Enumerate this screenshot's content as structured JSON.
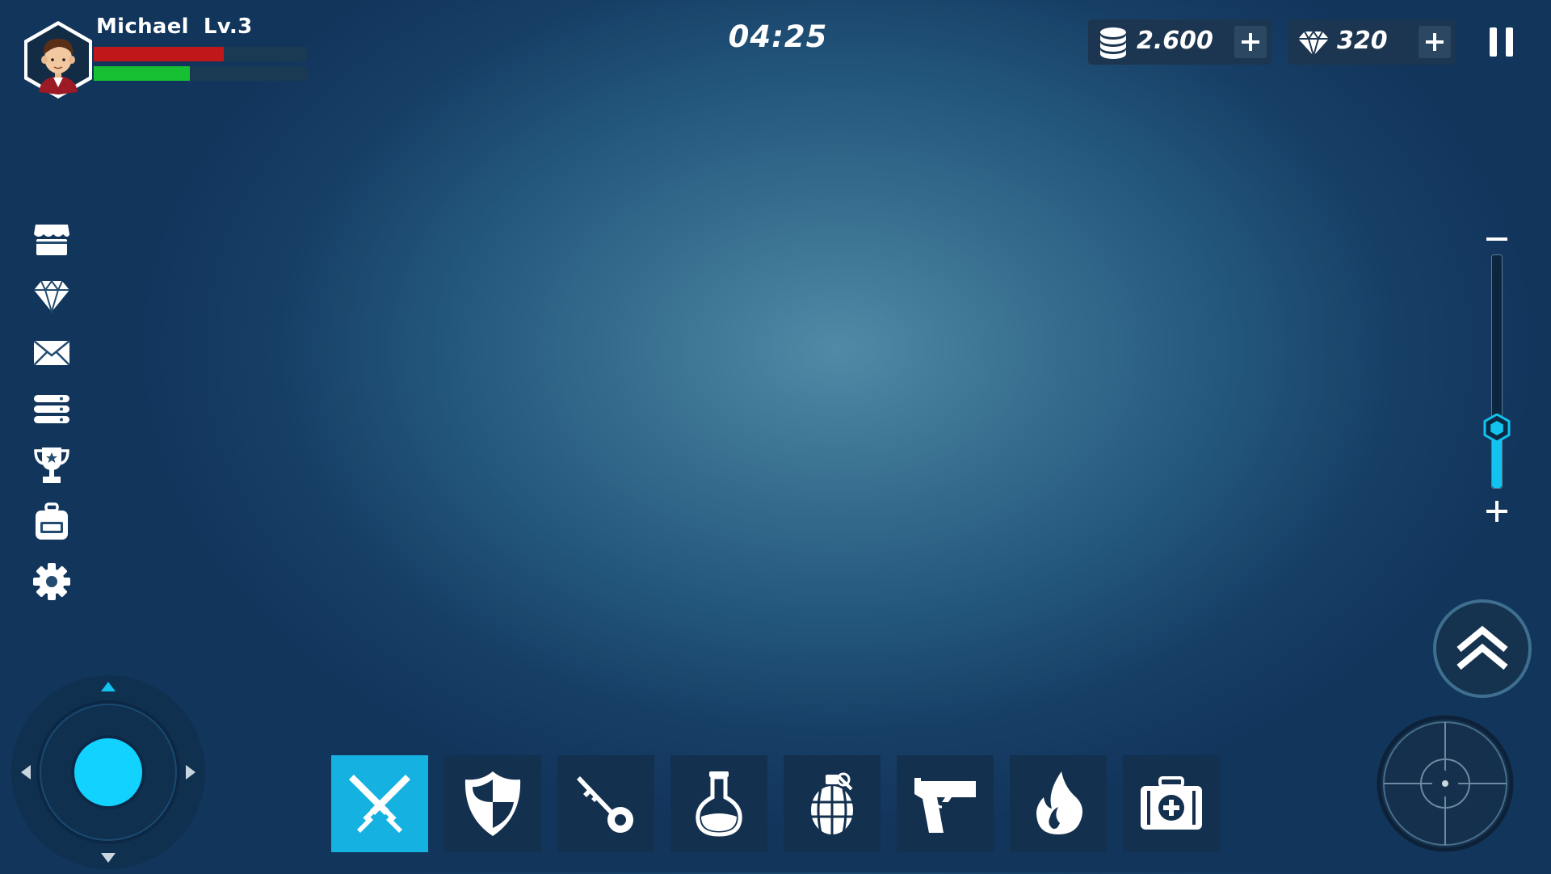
{
  "player": {
    "name": "Michael",
    "level": "Lv.3",
    "health_fraction": 0.61,
    "energy_fraction": 0.45,
    "avatar": "boy-portrait-avatar"
  },
  "timer": "04:25",
  "currencies": {
    "coins": {
      "value": "2.600",
      "icon": "coin-stack-icon"
    },
    "gems": {
      "value": "320",
      "icon": "diamond-icon"
    }
  },
  "sidebar": {
    "items": [
      {
        "icon": "shop-icon"
      },
      {
        "icon": "diamond-icon"
      },
      {
        "icon": "mail-icon"
      },
      {
        "icon": "list-icon"
      },
      {
        "icon": "trophy-icon"
      },
      {
        "icon": "backpack-icon"
      },
      {
        "icon": "gear-icon"
      }
    ]
  },
  "zoom": {
    "level": 0.26
  },
  "hotbar": {
    "active_index": 0,
    "items": [
      {
        "icon": "crossed-swords-icon"
      },
      {
        "icon": "shield-icon"
      },
      {
        "icon": "key-icon"
      },
      {
        "icon": "potion-flask-icon"
      },
      {
        "icon": "grenade-icon"
      },
      {
        "icon": "pistol-icon"
      },
      {
        "icon": "fire-icon"
      },
      {
        "icon": "first-aid-kit-icon"
      }
    ]
  },
  "colors": {
    "accent": "#14b1e1",
    "health": "#c0171b",
    "energy": "#16c032",
    "panel": "#13304e",
    "joystick_knob": "#12d2ff"
  }
}
